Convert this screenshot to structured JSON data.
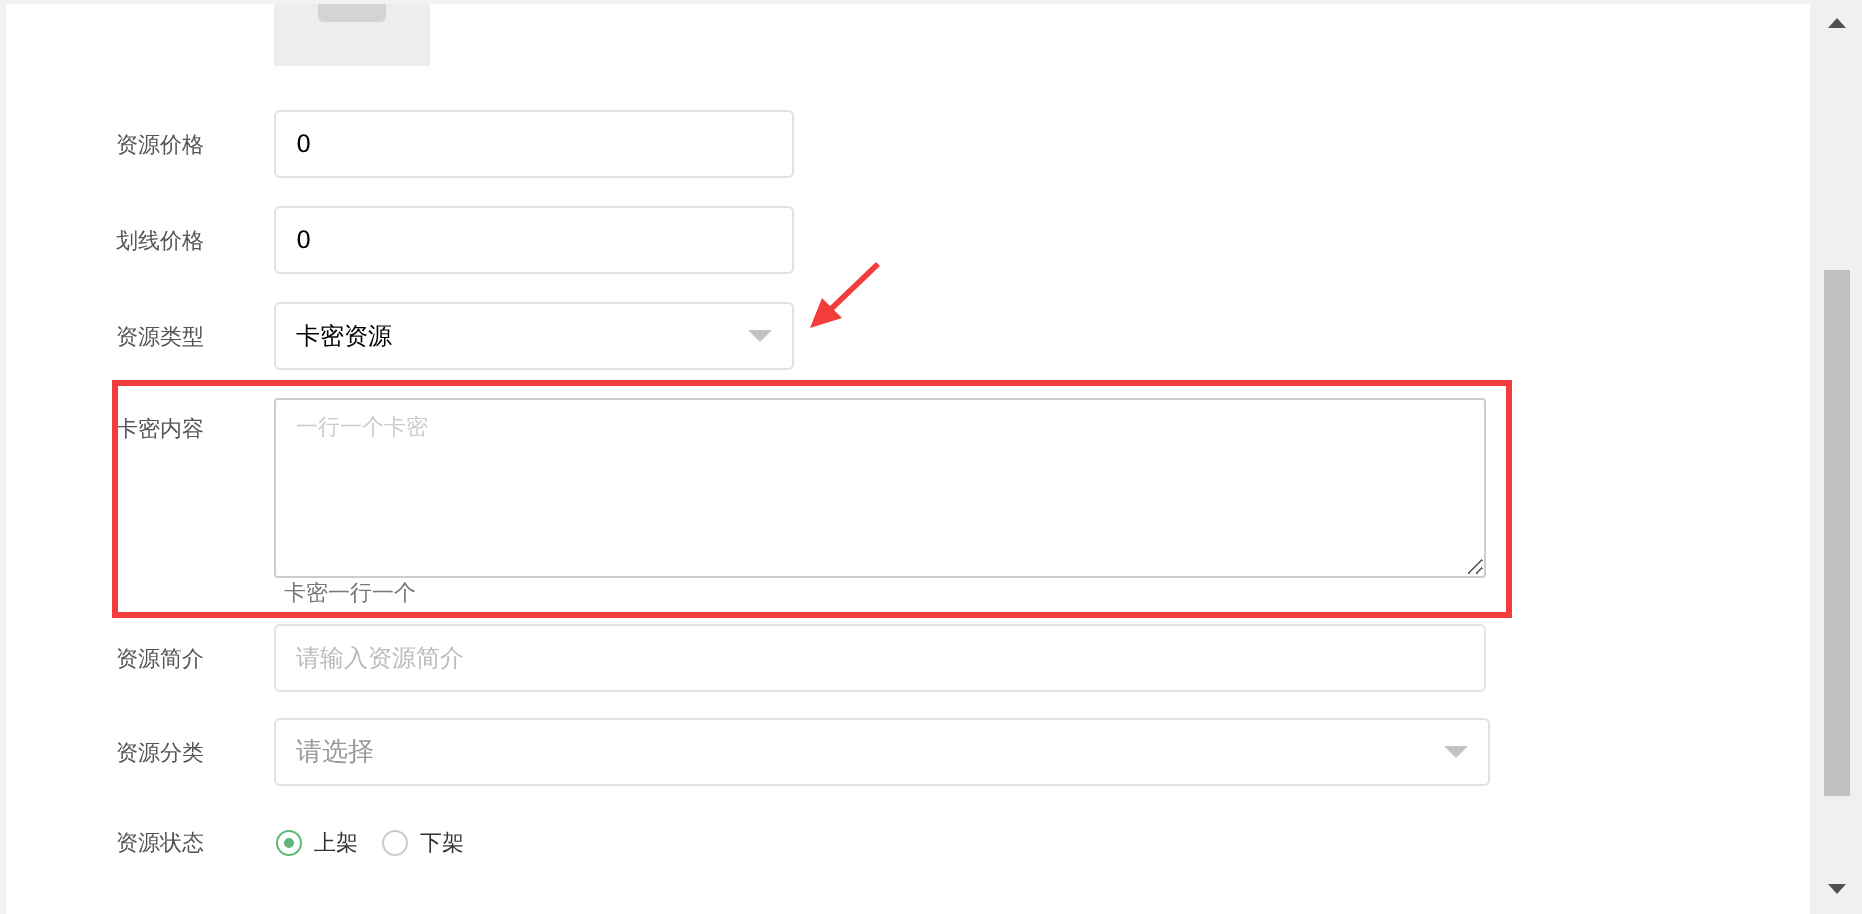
{
  "fields": [
    {
      "kind": "input",
      "label": "资源价格",
      "value": "0"
    },
    {
      "kind": "input",
      "label": "划线价格",
      "value": "0"
    },
    {
      "kind": "select",
      "label": "资源类型",
      "value": "卡密资源"
    },
    {
      "kind": "textarea",
      "label": "卡密内容",
      "placeholder": "一行一个卡密",
      "hint": "卡密一行一个"
    },
    {
      "kind": "input",
      "label": "资源简介",
      "placeholder": "请输入资源简介"
    },
    {
      "kind": "select",
      "label": "资源分类",
      "placeholder": "请选择"
    },
    {
      "kind": "radio",
      "label": "资源状态",
      "options": [
        {
          "label": "上架",
          "selected": true
        },
        {
          "label": "下架",
          "selected": false
        }
      ]
    }
  ]
}
